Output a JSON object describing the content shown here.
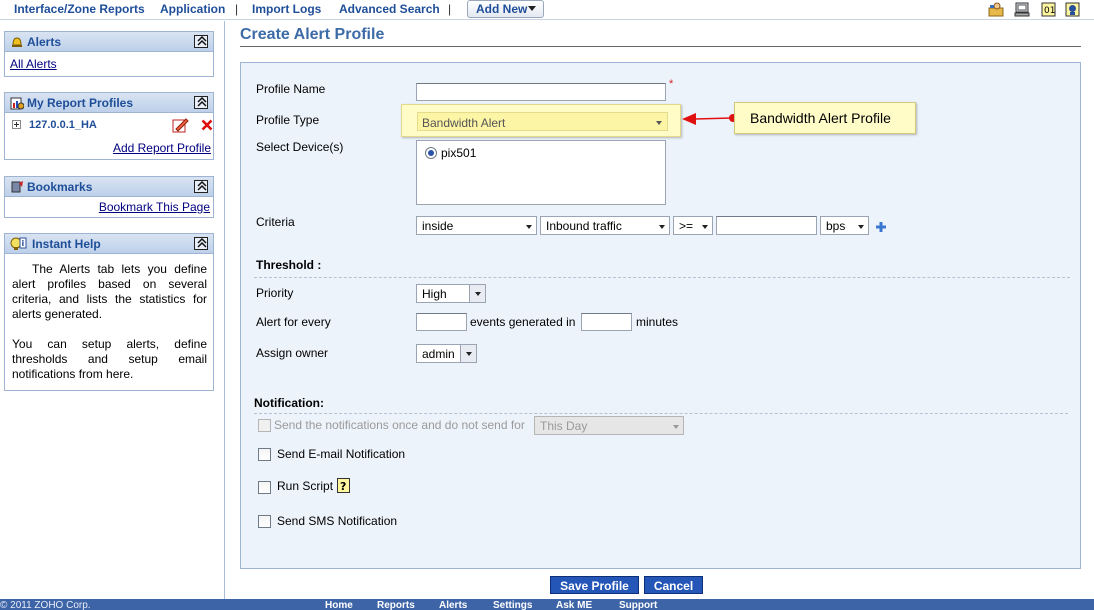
{
  "topnav": {
    "items": [
      "Interface/Zone Reports",
      "Application",
      "Import Logs",
      "Advanced Search"
    ],
    "add_new": "Add New"
  },
  "sidebar": {
    "alerts": {
      "title": "Alerts",
      "link": "All Alerts"
    },
    "report_profiles": {
      "title": "My Report Profiles",
      "item": "127.0.0.1_HA",
      "add_link": "Add Report Profile"
    },
    "bookmarks": {
      "title": "Bookmarks",
      "link": "Bookmark This Page"
    },
    "instant_help": {
      "title": "Instant Help",
      "para1": "The Alerts tab lets you define alert profiles based on several criteria, and lists the statistics for alerts generated.",
      "para2": "You can setup alerts, define thresholds and setup email notifications from here."
    }
  },
  "page": {
    "title": "Create Alert Profile"
  },
  "form": {
    "profile_name": {
      "label": "Profile Name",
      "value": "",
      "required_mark": "*"
    },
    "profile_type": {
      "label": "Profile Type",
      "value": "Bandwidth Alert",
      "callout": "Bandwidth Alert Profile"
    },
    "devices": {
      "label": "Select Device(s)",
      "items": [
        "pix501"
      ]
    },
    "criteria": {
      "label": "Criteria",
      "interface": "inside",
      "direction": "Inbound traffic",
      "operator": ">=",
      "value": "",
      "unit": "bps"
    },
    "threshold": {
      "heading": "Threshold :",
      "priority": {
        "label": "Priority",
        "value": "High"
      },
      "alert_every": {
        "label": "Alert for every",
        "mid": "events generated in",
        "suffix": "minutes"
      },
      "owner": {
        "label": "Assign owner",
        "value": "admin"
      }
    },
    "notification": {
      "heading": "Notification:",
      "once": {
        "label": "Send the notifications once and do not send for",
        "value": "This Day"
      },
      "email": "Send E-mail Notification",
      "script": "Run Script",
      "sms": "Send SMS Notification"
    }
  },
  "buttons": {
    "save": "Save Profile",
    "cancel": "Cancel"
  },
  "footer": {
    "copyright": "© 2011 ZOHO Corp.",
    "links": [
      "Home",
      "Reports",
      "Alerts",
      "Settings",
      "Ask ME",
      "Support"
    ]
  },
  "colors": {
    "brand_blue": "#1f4e99",
    "button_blue": "#2456b8",
    "tooltip_yellow": "#fffcc8",
    "form_bg": "#edf3fb"
  }
}
